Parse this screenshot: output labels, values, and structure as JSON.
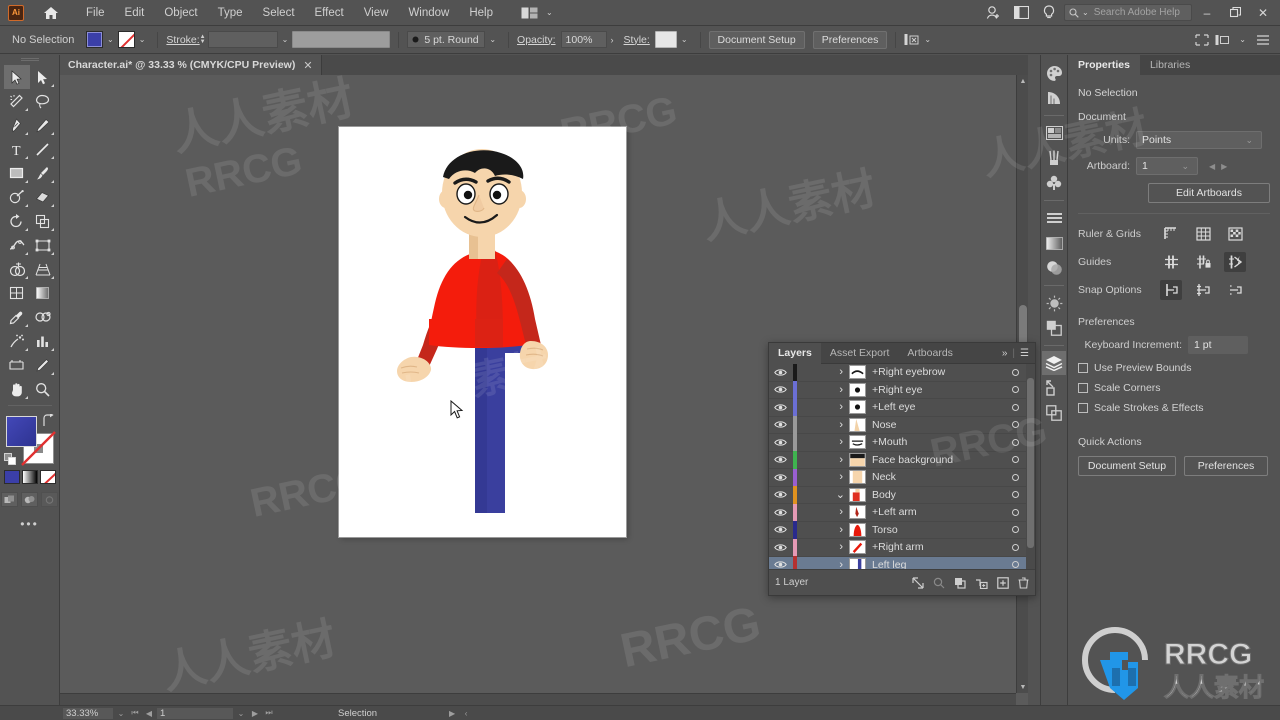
{
  "app": {
    "name": "Adobe Illustrator",
    "logo_text": "Ai",
    "home_icon": "home-icon"
  },
  "menubar": {
    "items": [
      "File",
      "Edit",
      "Object",
      "Type",
      "Select",
      "Effect",
      "View",
      "Window",
      "Help"
    ],
    "arrange_icon": "arrange-documents-icon",
    "arrange_caret": "⌄",
    "right_icons": [
      "add-user-icon",
      "workspace-switcher-icon",
      "discover-icon"
    ],
    "search": {
      "placeholder": "Search Adobe Help",
      "icon": "search-icon",
      "caret": "⌄"
    },
    "window_controls": {
      "minimize": "–",
      "restore": "❐",
      "close": "✕"
    }
  },
  "controlbar": {
    "selection_status": "No Selection",
    "fill_swatch": "fill-swatch",
    "stroke_swatch": "stroke-swatch-none",
    "stroke_label": "Stroke:",
    "stroke_weight": "",
    "stroke_profile": "",
    "brush_definition": "5 pt. Round",
    "opacity_label": "Opacity:",
    "opacity_value": "100%",
    "style_label": "Style:",
    "document_setup_label": "Document Setup",
    "preferences_label": "Preferences",
    "align_icon": "align-to-selection-icon",
    "caret": "⌄",
    "right_icons": [
      "arrange-objects-icon",
      "hamburger-icon"
    ]
  },
  "tabbar": {
    "document_title": "Character.ai* @ 33.33 % (CMYK/CPU Preview)",
    "close_glyph": "✕"
  },
  "toolbar": {
    "tools": [
      {
        "name": "selection-tool",
        "glyph": "↖",
        "selected": true,
        "corner": false
      },
      {
        "name": "direct-selection-tool",
        "glyph": "↗",
        "selected": false,
        "corner": true
      },
      {
        "name": "magic-wand-tool",
        "glyph": "✦",
        "selected": false,
        "corner": true
      },
      {
        "name": "lasso-tool",
        "glyph": "❁",
        "selected": false,
        "corner": false
      },
      {
        "name": "pen-tool",
        "glyph": "✒",
        "selected": false,
        "corner": true
      },
      {
        "name": "curvature-tool",
        "glyph": "✎",
        "selected": false,
        "corner": false
      },
      {
        "name": "type-tool",
        "glyph": "T",
        "selected": false,
        "corner": true
      },
      {
        "name": "line-segment-tool",
        "glyph": "╱",
        "selected": false,
        "corner": true
      },
      {
        "name": "rectangle-tool",
        "glyph": "□",
        "selected": false,
        "corner": true
      },
      {
        "name": "paintbrush-tool",
        "glyph": "὘C",
        "selected": false,
        "corner": true
      },
      {
        "name": "shaper-tool",
        "glyph": "◌",
        "selected": false,
        "corner": true
      },
      {
        "name": "eraser-tool",
        "glyph": "◇",
        "selected": false,
        "corner": true
      },
      {
        "name": "rotate-tool",
        "glyph": "↺",
        "selected": false,
        "corner": true
      },
      {
        "name": "scale-tool",
        "glyph": "⤢",
        "selected": false,
        "corner": true
      },
      {
        "name": "width-tool",
        "glyph": "⤳",
        "selected": false,
        "corner": true
      },
      {
        "name": "free-transform-tool",
        "glyph": "⬚",
        "selected": false,
        "corner": true
      },
      {
        "name": "shape-builder-tool",
        "glyph": "◔",
        "selected": false,
        "corner": true
      },
      {
        "name": "perspective-grid-tool",
        "glyph": "▦",
        "selected": false,
        "corner": true
      },
      {
        "name": "mesh-tool",
        "glyph": "⊞",
        "selected": false,
        "corner": false
      },
      {
        "name": "gradient-tool",
        "glyph": "▤",
        "selected": false,
        "corner": false
      },
      {
        "name": "eyedropper-tool",
        "glyph": "✐",
        "selected": false,
        "corner": true
      },
      {
        "name": "blend-tool",
        "glyph": "◎",
        "selected": false,
        "corner": false
      },
      {
        "name": "symbol-sprayer-tool",
        "glyph": "⁂",
        "selected": false,
        "corner": true
      },
      {
        "name": "column-graph-tool",
        "glyph": "█",
        "selected": false,
        "corner": true
      },
      {
        "name": "artboard-tool",
        "glyph": "⬜",
        "selected": false,
        "corner": false
      },
      {
        "name": "slice-tool",
        "glyph": "✂",
        "selected": false,
        "corner": true
      },
      {
        "name": "hand-tool",
        "glyph": "✋",
        "selected": false,
        "corner": true
      },
      {
        "name": "zoom-tool",
        "glyph": "⚲",
        "selected": false,
        "corner": false
      }
    ],
    "fill_label": "fill-color",
    "stroke_label": "stroke-color",
    "swap_icon": "swap-fill-stroke-icon",
    "default_icon": "default-fill-stroke-icon",
    "color_modes": [
      "color-swatch",
      "gradient-swatch",
      "none-swatch"
    ],
    "screen_modes": [
      "draw-normal-icon",
      "draw-behind-icon",
      "draw-inside-icon"
    ],
    "more_glyph": "•••"
  },
  "canvas": {
    "artboard_name": "artboard-1",
    "zoom": "33.33%",
    "cursor_icon": "selection-cursor"
  },
  "layers_panel": {
    "tabs": [
      {
        "label": "Layers",
        "active": true
      },
      {
        "label": "Asset Export",
        "active": false
      },
      {
        "label": "Artboards",
        "active": false
      }
    ],
    "collapse_glyph": "»",
    "menu_glyph": "☰",
    "rows": [
      {
        "name": "+Right eyebrow",
        "color": "#1a1a1a",
        "expandable": true,
        "expanded": false,
        "selected": false,
        "indent": 1,
        "thumb": "eyebrow-thumb"
      },
      {
        "name": "+Right eye",
        "color": "#6b6fd4",
        "expandable": true,
        "expanded": false,
        "selected": false,
        "indent": 1,
        "thumb": "eye-thumb"
      },
      {
        "name": "+Left eye",
        "color": "#6b6fd4",
        "expandable": true,
        "expanded": false,
        "selected": false,
        "indent": 1,
        "thumb": "eye-thumb"
      },
      {
        "name": "Nose",
        "color": "#9a9a9a",
        "expandable": true,
        "expanded": false,
        "selected": false,
        "indent": 1,
        "thumb": "nose-thumb"
      },
      {
        "name": "+Mouth",
        "color": "#9a9a9a",
        "expandable": true,
        "expanded": false,
        "selected": false,
        "indent": 1,
        "thumb": "mouth-thumb"
      },
      {
        "name": "Face background",
        "color": "#3fb34f",
        "expandable": true,
        "expanded": false,
        "selected": false,
        "indent": 1,
        "thumb": "face-thumb"
      },
      {
        "name": "Neck",
        "color": "#9a5fd0",
        "expandable": true,
        "expanded": false,
        "selected": false,
        "indent": 1,
        "thumb": "neck-thumb"
      },
      {
        "name": "Body",
        "color": "#e0921f",
        "expandable": true,
        "expanded": true,
        "selected": false,
        "indent": 0,
        "thumb": "body-thumb"
      },
      {
        "name": "+Left arm",
        "color": "#e59ab5",
        "expandable": true,
        "expanded": false,
        "selected": false,
        "indent": 1,
        "thumb": "leftarm-thumb"
      },
      {
        "name": "Torso",
        "color": "#2a2a8c",
        "expandable": true,
        "expanded": false,
        "selected": false,
        "indent": 1,
        "thumb": "torso-thumb"
      },
      {
        "name": "+Right arm",
        "color": "#e59ab5",
        "expandable": true,
        "expanded": false,
        "selected": false,
        "indent": 1,
        "thumb": "rightarm-thumb"
      },
      {
        "name": "Left leg",
        "color": "#b43030",
        "expandable": true,
        "expanded": false,
        "selected": true,
        "indent": 1,
        "thumb": "leftleg-thumb"
      }
    ],
    "footer_status": "1 Layer",
    "footer_buttons": [
      "locate-object-icon",
      "make-clipping-mask-icon",
      "create-new-sublayer-icon",
      "create-new-layer-icon",
      "delete-selection-icon"
    ]
  },
  "dock_strip": {
    "icons": [
      "color-icon",
      "color-guide-icon",
      "image-trace-icon",
      "brushes-icon",
      "symbols-icon",
      "stroke-icon",
      "gradient-icon",
      "transparency-icon",
      "appearance-icon",
      "graphic-styles-icon",
      "layers-icon",
      "asset-export-icon",
      "artboards-icon"
    ],
    "active": "layers-icon"
  },
  "properties_panel": {
    "tabs": [
      {
        "label": "Properties",
        "active": true
      },
      {
        "label": "Libraries",
        "active": false
      }
    ],
    "selection_status": "No Selection",
    "document_section": "Document",
    "units_label": "Units:",
    "units_value": "Points",
    "artboard_label": "Artboard:",
    "artboard_value": "1",
    "artboard_prev": "◀",
    "artboard_next": "▶",
    "edit_artboards_label": "Edit Artboards",
    "ruler_grids_label": "Ruler & Grids",
    "ruler_grids_icons": [
      "show-rulers-icon",
      "show-grid-icon",
      "show-transparency-grid-icon"
    ],
    "guides_label": "Guides",
    "guides_icons": [
      "show-guides-icon",
      "lock-guides-icon",
      "smart-guides-icon"
    ],
    "guides_active": "smart-guides-icon",
    "snap_options_label": "Snap Options",
    "snap_icons": [
      "snap-to-point-icon",
      "snap-to-grid-icon",
      "snap-to-pixel-icon"
    ],
    "snap_active": "snap-to-point-icon",
    "preferences_section": "Preferences",
    "keyboard_increment_label": "Keyboard Increment:",
    "keyboard_increment_value": "1 pt",
    "checkboxes": [
      {
        "label": "Use Preview Bounds",
        "checked": false
      },
      {
        "label": "Scale Corners",
        "checked": false
      },
      {
        "label": "Scale Strokes & Effects",
        "checked": false
      }
    ],
    "quick_actions_label": "Quick Actions",
    "document_setup_label": "Document Setup",
    "preferences_label": "Preferences",
    "caret": "⌄"
  },
  "statusbar": {
    "zoom_value": "33.33%",
    "zoom_caret": "⌄",
    "nav_first": "⏮",
    "nav_prev": "◀",
    "artboard_value": "1",
    "artboard_caret": "⌄",
    "nav_next": "▶",
    "nav_last": "⏭",
    "tool_status": "Selection",
    "status_play": "▶",
    "status_more": "‹"
  },
  "watermark": {
    "brand": "RRCG",
    "brand_cn": "人人素材",
    "tiles": [
      "RRCG",
      "人人素材",
      "RRCG",
      "人人素材",
      "RRCG",
      "人人素材",
      "RRCG",
      "人人素材",
      "RRCG",
      "人人素材"
    ]
  },
  "artwork": {
    "title": "cartoon-boy-character",
    "colors": {
      "hair": "#1a1a1a",
      "skin": "#f6d5ac",
      "skin_shadow": "#e8c192",
      "shirt": "#f41c0c",
      "shirt_shadow": "#c4271b",
      "pants": "#3a3f9e",
      "pants_shadow": "#2f3488",
      "eye_white": "#ffffff",
      "pupil": "#111111"
    }
  }
}
